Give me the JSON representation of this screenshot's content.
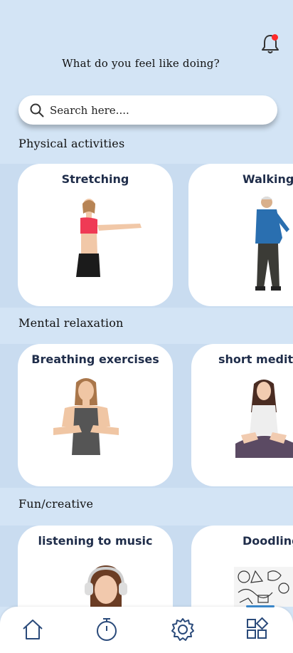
{
  "header": {
    "prompt": "What do you feel like doing?"
  },
  "notifications": {
    "has_unread": true,
    "dot_color": "#ff2a2a"
  },
  "search": {
    "placeholder": "Search here...."
  },
  "sections": [
    {
      "title": "Physical activities",
      "cards": [
        {
          "label": "Stretching"
        },
        {
          "label": "Walking"
        }
      ]
    },
    {
      "title": "Mental relaxation",
      "cards": [
        {
          "label": "Breathing exercises"
        },
        {
          "label": "short meditat"
        }
      ]
    },
    {
      "title": "Fun/creative",
      "cards": [
        {
          "label": "listening to music"
        },
        {
          "label": "Doodling"
        }
      ]
    }
  ],
  "bottom_nav": {
    "items": [
      "home-icon",
      "timer-icon",
      "gear-icon",
      "apps-icon"
    ],
    "active_color": "#3a86c8"
  },
  "colors": {
    "background": "#d3e4f5",
    "card": "#ffffff",
    "card_title": "#1f2d4a"
  }
}
